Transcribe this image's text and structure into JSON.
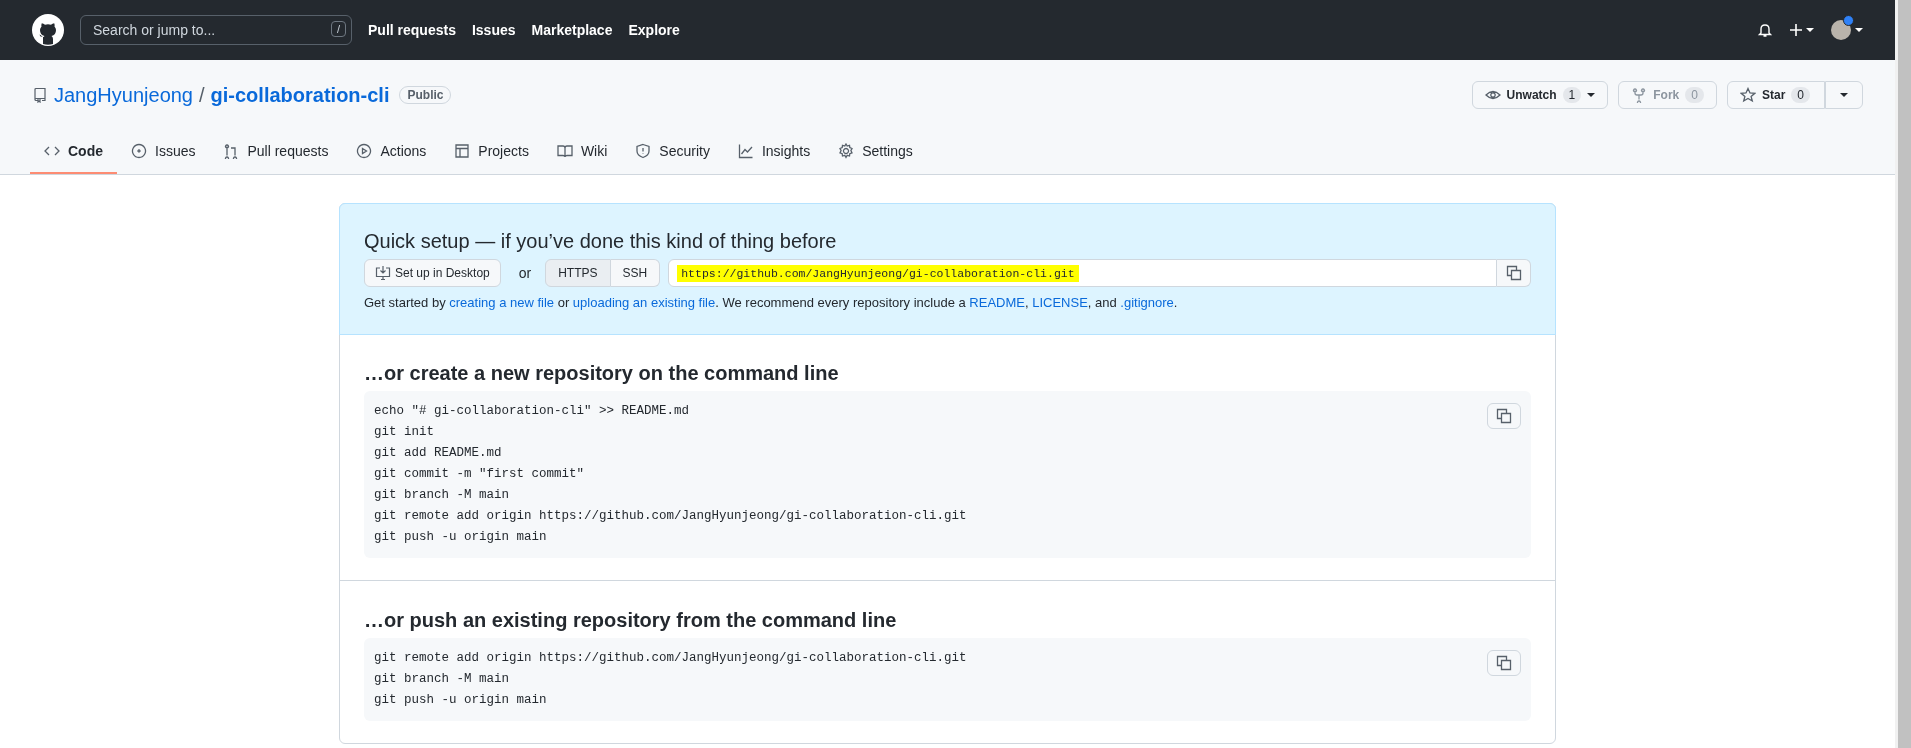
{
  "header": {
    "search": {
      "placeholder": "Search or jump to...",
      "shortcut": "/"
    },
    "nav": [
      "Pull requests",
      "Issues",
      "Marketplace",
      "Explore"
    ],
    "unread_notifications": true
  },
  "repo": {
    "owner": "JangHyunjeong",
    "separator": "/",
    "name": "gi-collaboration-cli",
    "visibility": "Public"
  },
  "actions": [
    {
      "kind": "watch",
      "label": "Unwatch",
      "count": "1",
      "disabled": false
    },
    {
      "kind": "fork",
      "label": "Fork",
      "count": "0",
      "disabled": true
    },
    {
      "kind": "star",
      "label": "Star",
      "count": "0",
      "disabled": false
    }
  ],
  "tabs": [
    {
      "kind": "code",
      "label": "Code",
      "selected": true
    },
    {
      "kind": "issues",
      "label": "Issues",
      "selected": false
    },
    {
      "kind": "pulls",
      "label": "Pull requests",
      "selected": false
    },
    {
      "kind": "actions",
      "label": "Actions",
      "selected": false
    },
    {
      "kind": "projects",
      "label": "Projects",
      "selected": false
    },
    {
      "kind": "wiki",
      "label": "Wiki",
      "selected": false
    },
    {
      "kind": "security",
      "label": "Security",
      "selected": false
    },
    {
      "kind": "insights",
      "label": "Insights",
      "selected": false
    },
    {
      "kind": "settings",
      "label": "Settings",
      "selected": false
    }
  ],
  "quick_setup": {
    "title": "Quick setup — if you’ve done this kind of thing before",
    "desktop_button": "Set up in Desktop",
    "or": "or",
    "protocols": [
      {
        "label": "HTTPS",
        "selected": true
      },
      {
        "label": "SSH",
        "selected": false
      }
    ],
    "url": "https://github.com/JangHyunjeong/gi-collaboration-cli.git",
    "url_highlighted": true,
    "help": [
      {
        "text": "Get started by ",
        "link": false
      },
      {
        "text": "creating a new file",
        "link": true
      },
      {
        "text": " or ",
        "link": false
      },
      {
        "text": "uploading an existing file",
        "link": true
      },
      {
        "text": ". We recommend every repository include a ",
        "link": false
      },
      {
        "text": "README",
        "link": true
      },
      {
        "text": ", ",
        "link": false
      },
      {
        "text": "LICENSE",
        "link": true
      },
      {
        "text": ", and ",
        "link": false
      },
      {
        "text": ".gitignore",
        "link": true
      },
      {
        "text": ".",
        "link": false
      }
    ]
  },
  "sections": [
    {
      "title": "…or create a new repository on the command line",
      "code": [
        "echo \"# gi-collaboration-cli\" >> README.md",
        "git init",
        "git add README.md",
        "git commit -m \"first commit\"",
        "git branch -M main",
        "git remote add origin https://github.com/JangHyunjeong/gi-collaboration-cli.git",
        "git push -u origin main"
      ]
    },
    {
      "title": "…or push an existing repository from the command line",
      "code": [
        "git remote add origin https://github.com/JangHyunjeong/gi-collaboration-cli.git",
        "git branch -M main",
        "git push -u origin main"
      ]
    }
  ]
}
